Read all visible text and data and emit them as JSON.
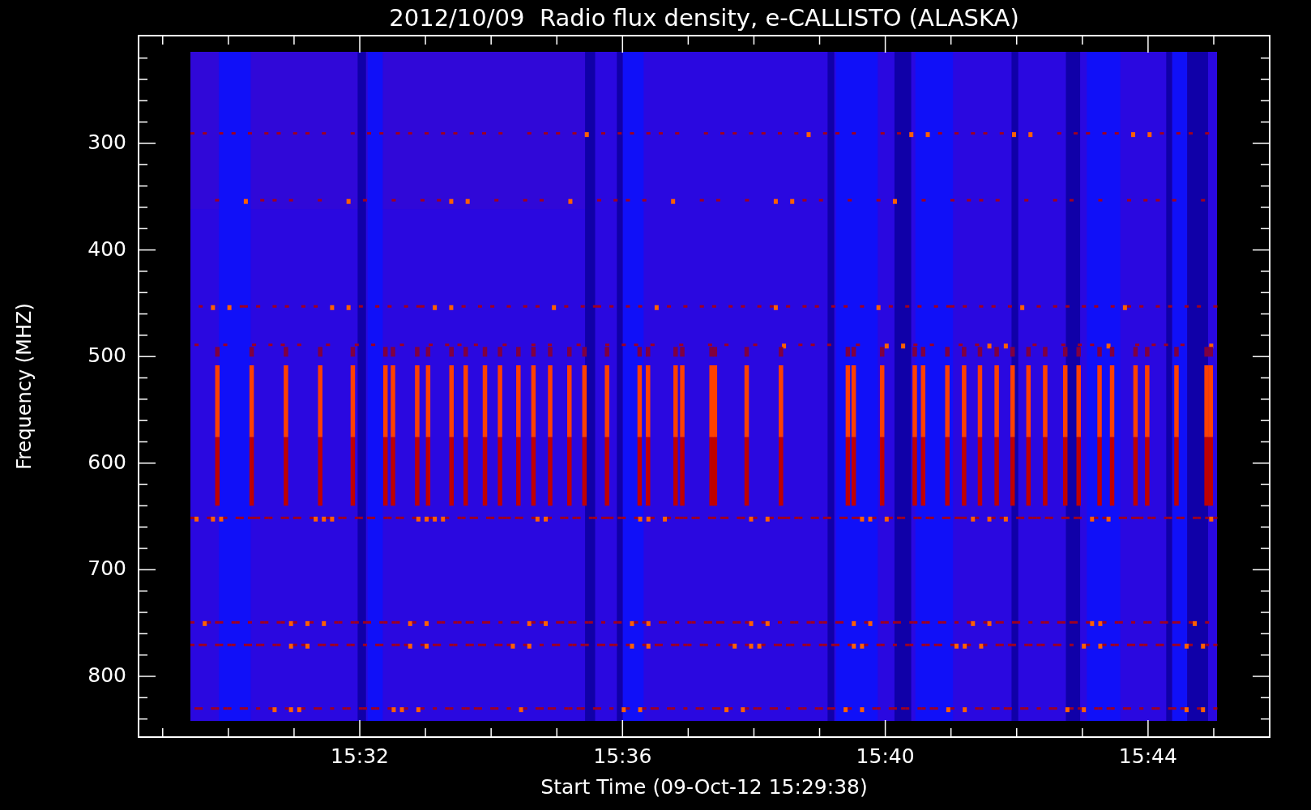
{
  "title": "2012/10/09  Radio flux density, e-CALLISTO (ALASKA)",
  "y_axis": {
    "label": "Frequency (MHZ)",
    "ticks": [
      "300",
      "400",
      "500",
      "600",
      "700",
      "800"
    ]
  },
  "x_axis": {
    "label": "Start Time (09-Oct-12 15:29:38)",
    "ticks": [
      "15:32",
      "15:36",
      "15:40",
      "15:44"
    ]
  }
}
